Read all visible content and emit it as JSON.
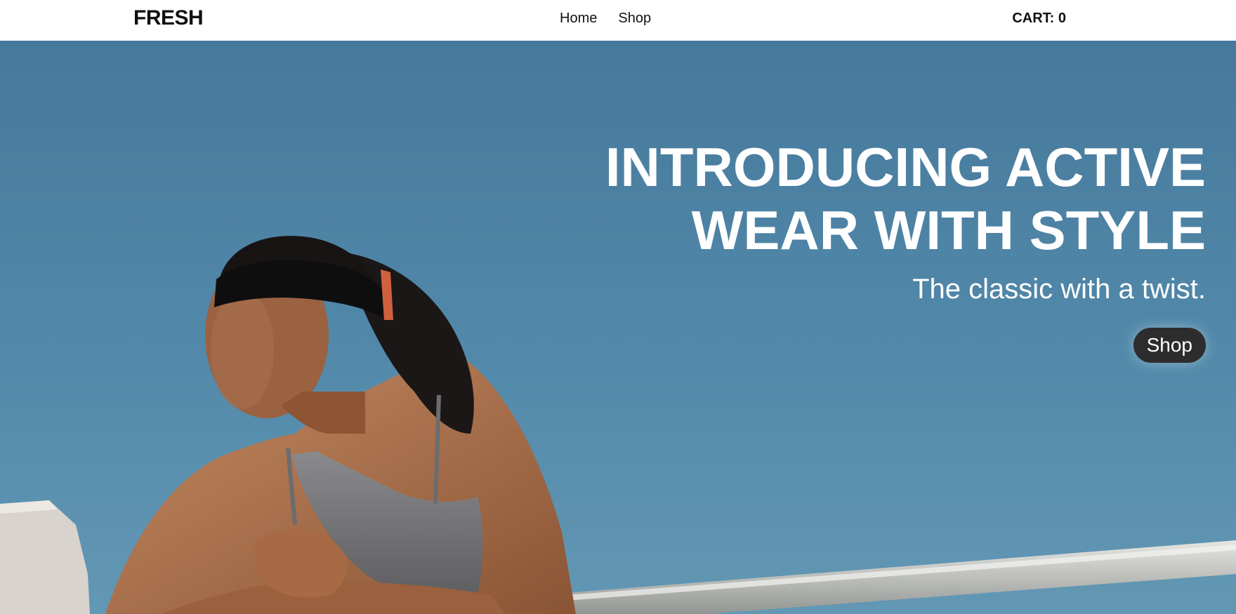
{
  "header": {
    "brand": "FRESH",
    "nav": [
      {
        "label": "Home"
      },
      {
        "label": "Shop"
      }
    ],
    "cart_label": "CART: 0"
  },
  "hero": {
    "title": "INTRODUCING ACTIVE WEAR WITH STYLE",
    "subtitle": "The classic with a twist.",
    "cta_label": "Shop",
    "colors": {
      "sky": "#4f86a8",
      "button": "#2d2d2d",
      "text": "#ffffff"
    }
  }
}
